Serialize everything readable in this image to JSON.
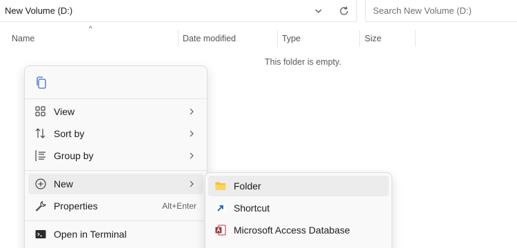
{
  "address_bar": {
    "path": "New Volume (D:)"
  },
  "search": {
    "placeholder": "Search New Volume (D:)"
  },
  "columns": [
    "Name",
    "Date modified",
    "Type",
    "Size"
  ],
  "empty_message": "This folder is empty.",
  "context_menu": {
    "items": [
      {
        "label": "View",
        "icon": "view-grid-icon",
        "submenu": true
      },
      {
        "label": "Sort by",
        "icon": "sort-icon",
        "submenu": true
      },
      {
        "label": "Group by",
        "icon": "group-icon",
        "submenu": true
      },
      {
        "label": "New",
        "icon": "new-plus-icon",
        "submenu": true
      },
      {
        "label": "Properties",
        "icon": "wrench-icon",
        "shortcut": "Alt+Enter"
      },
      {
        "label": "Open in Terminal",
        "icon": "terminal-icon"
      }
    ]
  },
  "new_submenu": {
    "items": [
      {
        "label": "Folder",
        "icon": "folder-icon"
      },
      {
        "label": "Shortcut",
        "icon": "shortcut-icon"
      },
      {
        "label": "Microsoft Access Database",
        "icon": "access-icon"
      }
    ]
  },
  "colors": {
    "menu_bg": "#f9f9f9",
    "hover_bg": "#ececec",
    "folder": "#f4c041",
    "shortcut": "#1f6fc5",
    "access": "#a4373a"
  }
}
